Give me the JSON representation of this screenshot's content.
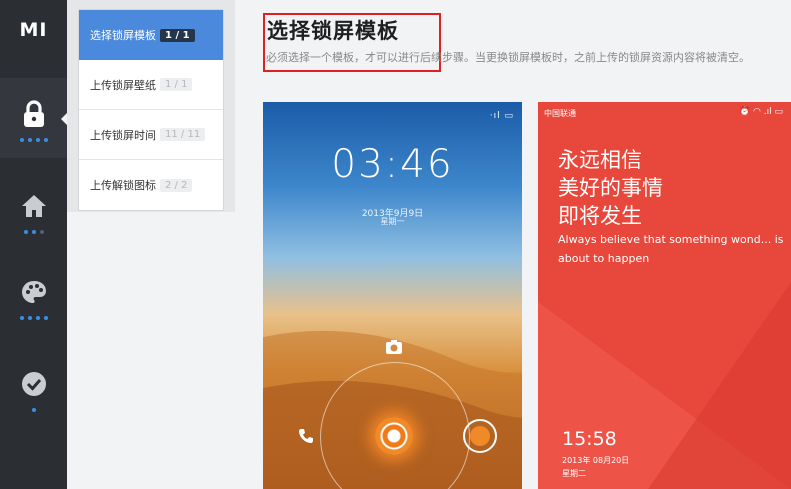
{
  "brand": {
    "logo": "MI"
  },
  "rail": {
    "items": [
      {
        "name": "lock",
        "icon": "lock-icon",
        "active": true,
        "dots": 4,
        "lit": 4
      },
      {
        "name": "home",
        "icon": "home-icon",
        "active": false,
        "dots": 3,
        "lit": 2
      },
      {
        "name": "theme",
        "icon": "palette-icon",
        "active": false,
        "dots": 4,
        "lit": 4
      },
      {
        "name": "done",
        "icon": "check-circle-icon",
        "active": false,
        "dots": 1,
        "lit": 1
      }
    ]
  },
  "submenu": {
    "items": [
      {
        "label": "选择锁屏模板",
        "count": "1 / 1",
        "active": true
      },
      {
        "label": "上传锁屏壁纸",
        "count": "1 / 1",
        "active": false
      },
      {
        "label": "上传锁屏时间",
        "count": "11 / 11",
        "active": false
      },
      {
        "label": "上传解锁图标",
        "count": "2 / 2",
        "active": false
      }
    ]
  },
  "main": {
    "title": "选择锁屏模板",
    "subtitle": "必须选择一个模板，才可以进行后续步骤。当更换锁屏模板时，之前上传的锁屏资源内容将被清空。"
  },
  "templates": [
    {
      "clock": "03:46",
      "date": "2013年9月9日",
      "weekday": "星期一",
      "status_icons": "⋅ıl ▭"
    },
    {
      "carrier": "中国联通",
      "status_icons": "⏰ ◠ .ıl ▭",
      "quote_cn": [
        "永远相信",
        "美好的事情",
        "即将发生"
      ],
      "quote_en": "Always believe that something wond... is about to happen",
      "clock": "15:58",
      "date": "2013年 08月20日",
      "weekday": "星期二"
    }
  ],
  "colors": {
    "rail_bg": "#2b2e33",
    "accent": "#4a89dc",
    "highlight_box": "#e02020",
    "card2_bg": "#e8473c"
  }
}
